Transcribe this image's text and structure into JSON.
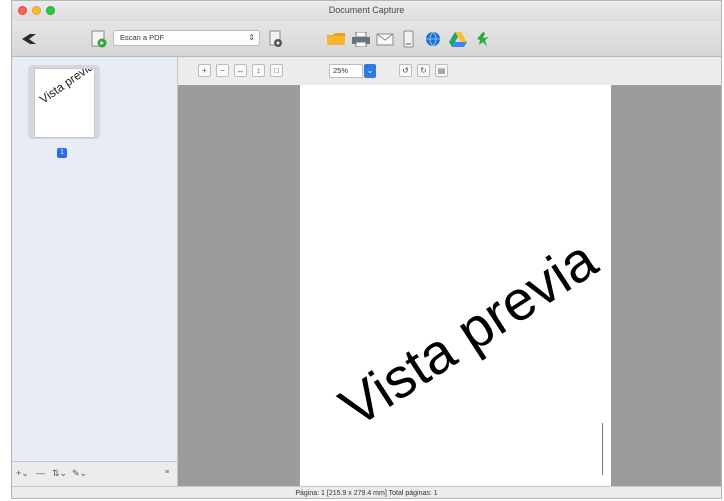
{
  "window": {
    "title": "Document Capture"
  },
  "toolbar": {
    "scan_setting": "Escan a PDF",
    "icons": [
      "back-icon",
      "scan-icon",
      "settings-icon",
      "folder-icon",
      "print-icon",
      "email-icon",
      "device-icon",
      "globe-icon",
      "drive-icon",
      "evernote-icon"
    ]
  },
  "sidebar": {
    "thumbnail_text": "Vista previa",
    "page_badge": "1"
  },
  "viewer": {
    "zoom": "25%",
    "page_text": "Vista previa"
  },
  "status": {
    "text": "Página: 1  [215.9 x 279.4 mm]  Total páginas: 1"
  },
  "colors": {
    "accent": "#2c7be5",
    "viewer_bg": "#9c9c9c"
  }
}
